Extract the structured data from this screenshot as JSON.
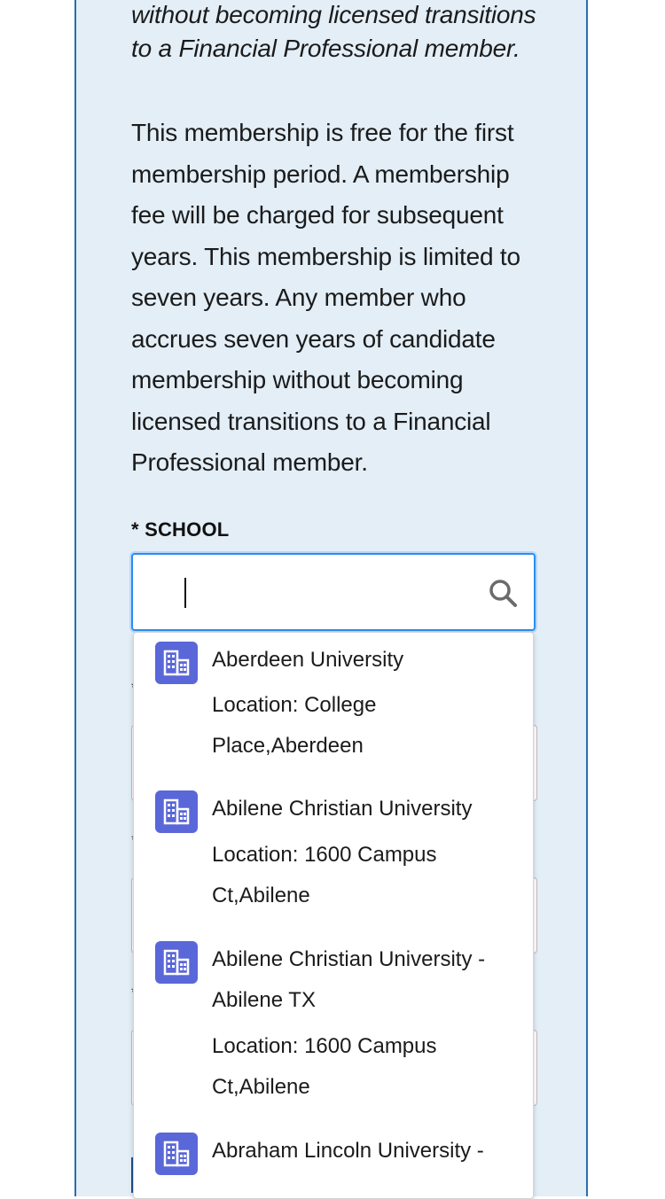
{
  "intro_italic": "without becoming licensed transitions to a Financial Professional member.",
  "body_paragraph": "This membership is free for the first membership period. A membership fee will be charged for subsequent years. This membership is limited to seven years. Any member who accrues seven years of candidate membership without becoming licensed transitions to a Financial Professional member.",
  "school_field": {
    "required_mark": "*",
    "label": "SCHOOL",
    "value": "",
    "icon": "search-icon"
  },
  "dropdown": {
    "options": [
      {
        "title": "Aberdeen University",
        "location": "Location: College Place,Aberdeen",
        "icon": "building-icon"
      },
      {
        "title": "Abilene Christian University",
        "location": "Location: 1600 Campus Ct,Abilene",
        "icon": "building-icon"
      },
      {
        "title": "Abilene Christian University - Abilene TX",
        "location": "Location: 1600 Campus Ct,Abilene",
        "icon": "building-icon"
      },
      {
        "title": "Abraham Lincoln University -",
        "location": "",
        "icon": "building-icon"
      }
    ]
  },
  "colors": {
    "card_background": "#e3eef7",
    "card_border": "#2a6fb0",
    "focus_border": "#2d8cf0",
    "icon_tile": "#5a67d8"
  }
}
